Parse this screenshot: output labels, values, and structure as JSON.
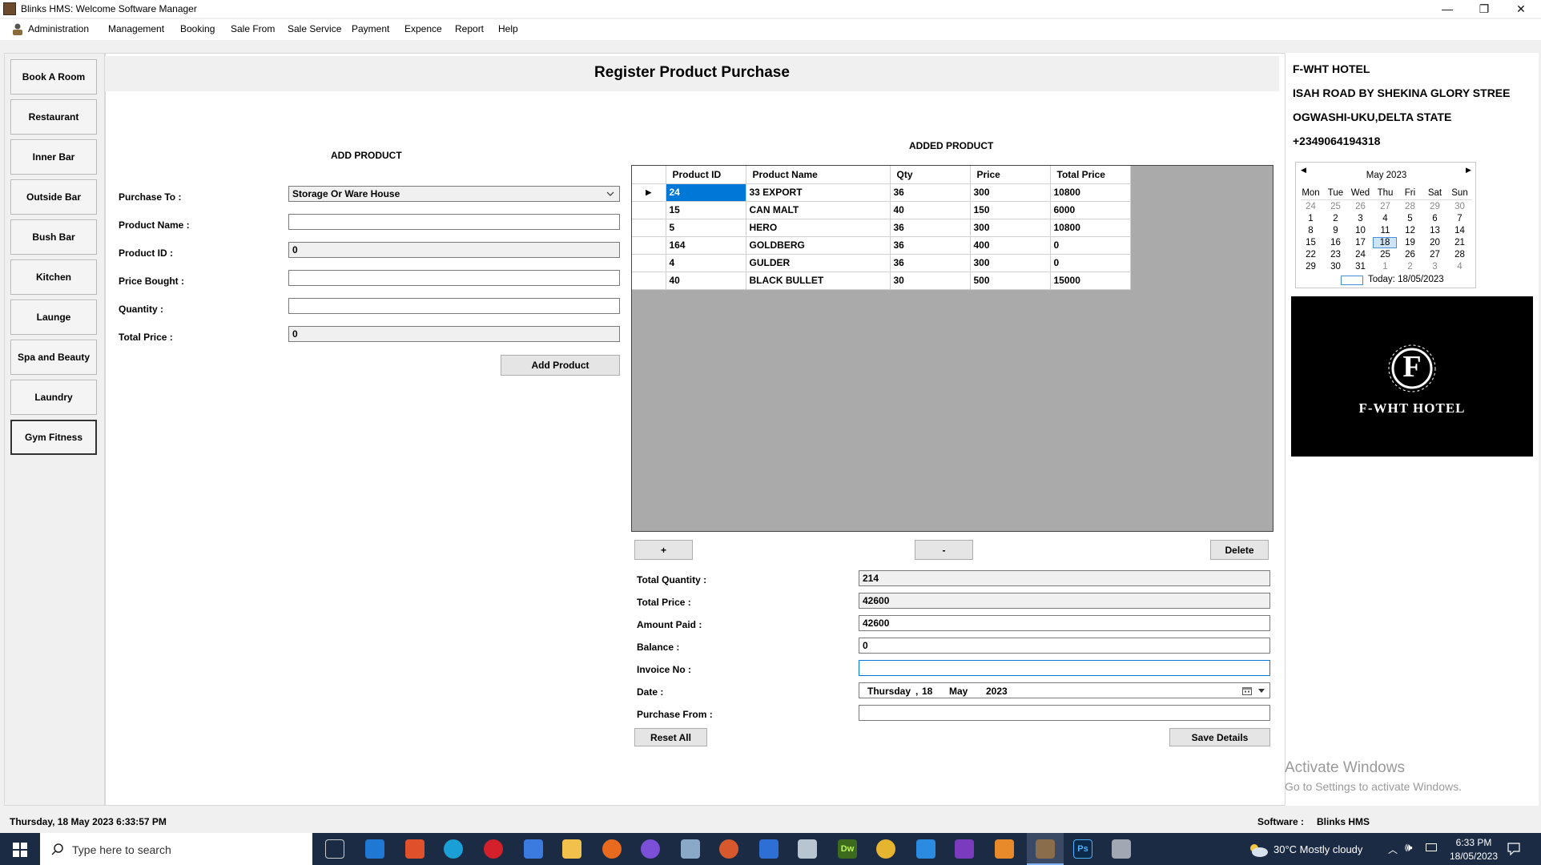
{
  "window": {
    "title": "Blinks HMS: Welcome Software Manager",
    "minimize": "—",
    "restore": "❐",
    "close": "✕"
  },
  "menu": [
    "Administration",
    "Management",
    "Booking",
    "Sale From",
    "Sale Service",
    "Payment",
    "Expence",
    "Report",
    "Help"
  ],
  "sidebar": {
    "items": [
      {
        "label": "Book A Room"
      },
      {
        "label": "Restaurant"
      },
      {
        "label": "Inner Bar"
      },
      {
        "label": "Outside Bar"
      },
      {
        "label": "Bush Bar"
      },
      {
        "label": "Kitchen"
      },
      {
        "label": "Launge"
      },
      {
        "label": "Spa and Beauty"
      },
      {
        "label": "Laundry"
      },
      {
        "label": "Gym  Fitness"
      }
    ]
  },
  "page": {
    "title": "Register Product Purchase"
  },
  "add_product": {
    "heading": "ADD PRODUCT",
    "purchase_to_label": "Purchase To :",
    "purchase_to_value": "Storage Or Ware House",
    "product_name_label": "Product Name :",
    "product_name_value": "",
    "product_id_label": "Product ID :",
    "product_id_value": "0",
    "price_bought_label": "Price Bought :",
    "price_bought_value": "",
    "quantity_label": "Quantity :",
    "quantity_value": "",
    "total_price_label": "Total Price :",
    "total_price_value": "0",
    "add_button": "Add Product"
  },
  "added_product": {
    "heading": "ADDED PRODUCT",
    "columns": [
      "Product ID",
      "Product Name",
      "Qty",
      "Price",
      "Total Price"
    ],
    "row_marker": "▶",
    "rows": [
      {
        "id": "24",
        "name": "33 EXPORT",
        "qty": "36",
        "price": "300",
        "total": "10800"
      },
      {
        "id": "15",
        "name": "CAN MALT",
        "qty": "40",
        "price": "150",
        "total": "6000"
      },
      {
        "id": "5",
        "name": "HERO",
        "qty": "36",
        "price": "300",
        "total": "10800"
      },
      {
        "id": "164",
        "name": "GOLDBERG",
        "qty": "36",
        "price": "400",
        "total": "0"
      },
      {
        "id": "4",
        "name": "GULDER",
        "qty": "36",
        "price": "300",
        "total": "0"
      },
      {
        "id": "40",
        "name": "BLACK BULLET",
        "qty": "30",
        "price": "500",
        "total": "15000"
      }
    ],
    "plus_button": "+",
    "minus_button": "-",
    "delete_button": "Delete"
  },
  "summary": {
    "total_quantity_label": "Total Quantity :",
    "total_quantity_value": "214",
    "total_price_label": "Total Price :",
    "total_price_value": "42600",
    "amount_paid_label": "Amount Paid :",
    "amount_paid_value": "42600",
    "balance_label": "Balance :",
    "balance_value": "0",
    "invoice_label": "Invoice No :",
    "invoice_value": "",
    "date_label": "Date :",
    "date_day": "Thursday",
    "date_sep": ",",
    "date_num": "18",
    "date_month": "May",
    "date_year": "2023",
    "purchase_from_label": "Purchase From :",
    "purchase_from_value": "",
    "reset_button": "Reset All",
    "save_button": "Save Details"
  },
  "hotel": {
    "name": "F-WHT HOTEL",
    "address1": "ISAH ROAD BY SHEKINA GLORY STREE",
    "address2": "OGWASHI-UKU,DELTA STATE",
    "phone": "+2349064194318",
    "logo_text": "F-WHT HOTEL",
    "logo_letter": "F"
  },
  "calendar": {
    "month_label": "May 2023",
    "prev": "◀",
    "next": "▶",
    "weekdays": [
      "Mon",
      "Tue",
      "Wed",
      "Thu",
      "Fri",
      "Sat",
      "Sun"
    ],
    "weeks": [
      [
        "24",
        "25",
        "26",
        "27",
        "28",
        "29",
        "30"
      ],
      [
        "1",
        "2",
        "3",
        "4",
        "5",
        "6",
        "7"
      ],
      [
        "8",
        "9",
        "10",
        "11",
        "12",
        "13",
        "14"
      ],
      [
        "15",
        "16",
        "17",
        "18",
        "19",
        "20",
        "21"
      ],
      [
        "22",
        "23",
        "24",
        "25",
        "26",
        "27",
        "28"
      ],
      [
        "29",
        "30",
        "31",
        "1",
        "2",
        "3",
        "4"
      ]
    ],
    "selected": "18",
    "today_label": "Today: 18/05/2023"
  },
  "watermark": {
    "line1": "Activate Windows",
    "line2": "Go to Settings to activate Windows."
  },
  "status": {
    "datetime": "Thursday, 18 May 2023 6:33:57 PM",
    "software_label": "Software :",
    "software_value": "Blinks HMS"
  },
  "taskbar": {
    "search_placeholder": "Type here to search",
    "weather": "30°C  Mostly cloudy",
    "time": "6:33 PM",
    "date": "18/05/2023"
  },
  "colors": {
    "selection": "#0078d7",
    "taskbar": "#1b2b44",
    "grid_bg": "#aaaaaa"
  }
}
